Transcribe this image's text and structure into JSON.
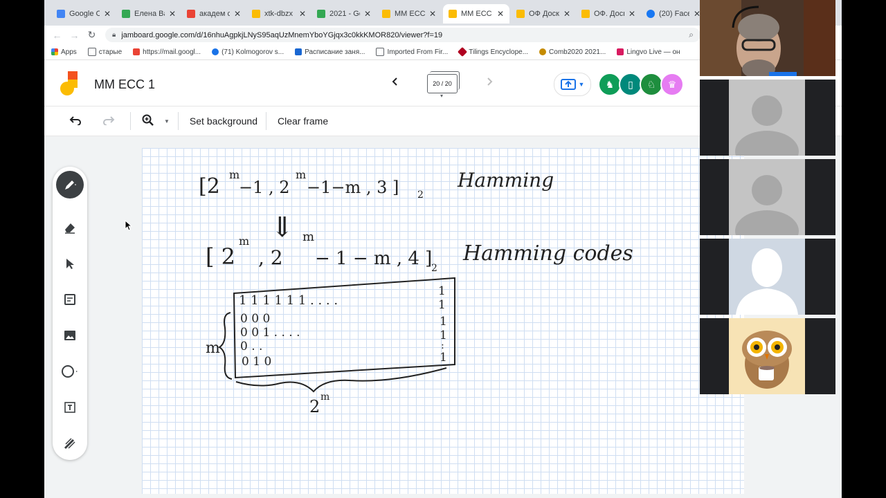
{
  "browser": {
    "tabs": [
      {
        "label": "Google C",
        "color": "#4285f4",
        "active": false
      },
      {
        "label": "Елена Ва",
        "color": "#34a853",
        "active": false
      },
      {
        "label": "академ с",
        "color": "#ea4335",
        "active": false
      },
      {
        "label": "xtk-dbzx",
        "color": "#fbbc04",
        "active": false
      },
      {
        "label": "2021 - Gc",
        "color": "#34a853",
        "active": false
      },
      {
        "label": "MM ECC",
        "color": "#fbbc04",
        "active": false
      },
      {
        "label": "MM ECC",
        "color": "#fbbc04",
        "active": true
      },
      {
        "label": "ОФ Доск",
        "color": "#fbbc04",
        "active": false
      },
      {
        "label": "ОФ. Доск",
        "color": "#fbbc04",
        "active": false
      },
      {
        "label": "(20) Face",
        "color": "#1877f2",
        "active": false
      }
    ],
    "url": "jamboard.google.com/d/16nhuAgpkjLNyS95aqUzMnemYboYGjqx3c0kkKMOR820/viewer?f=19",
    "bookmarks": [
      {
        "label": "Apps",
        "color": "#ea4335"
      },
      {
        "label": "старые",
        "color": "#5f6368"
      },
      {
        "label": "https://mail.googl...",
        "color": "#ea4335"
      },
      {
        "label": "(71) Kolmogorov s...",
        "color": "#1a73e8"
      },
      {
        "label": "Расписание заня...",
        "color": "#1967d2"
      },
      {
        "label": "Imported From Fir...",
        "color": "#5f6368"
      },
      {
        "label": "Tilings Encyclope...",
        "color": "#b00020"
      },
      {
        "label": "Comb2020 2021...",
        "color": "#c58b00"
      },
      {
        "label": "Lingvo Live — он",
        "color": "#d81b60"
      }
    ]
  },
  "jam": {
    "title": "MM ECC 1",
    "frame_counter": "20 / 20",
    "toolbar": {
      "set_background": "Set background",
      "clear_frame": "Clear frame"
    },
    "avatars": [
      {
        "color": "#0f9d58",
        "icon": "turtle"
      },
      {
        "color": "#00897b",
        "icon": "lighthouse"
      },
      {
        "color": "#1e8e3e",
        "icon": "horse"
      },
      {
        "color": "#e67cf2",
        "icon": "crown"
      }
    ],
    "rail_tools": [
      "pen-icon",
      "eraser-icon",
      "select-icon",
      "sticky-note-icon",
      "image-icon",
      "circle-icon",
      "text-box-icon",
      "laser-icon"
    ]
  },
  "board": {
    "line1_bracket": "[2",
    "line1_sup1": "m",
    "line1_mid": "−1 , 2",
    "line1_sup2": "m",
    "line1_rest": "−1−m , 3 ]",
    "line1_sub": "2",
    "line1_word": "Hamming",
    "arrow": "⇓",
    "line2_bracket": "[ 2",
    "line2_sup1": "m",
    "line2_mid": ", 2",
    "line2_sup2": "m",
    "line2_rest": "− 1 − m , 4 ]",
    "line2_sub": "2",
    "line2_word": "Hamming codes",
    "matrix_rows": [
      "1  1  1  1  1  1   . .  . .",
      "0   0   0",
      "0   0   1       .  . .  .",
      "0   .   .",
      "0   1   0"
    ],
    "matrix_right": [
      "1",
      "1",
      "1",
      "1",
      ":",
      "1"
    ],
    "m_label": "m",
    "width_base": "2",
    "width_sup": "m"
  }
}
